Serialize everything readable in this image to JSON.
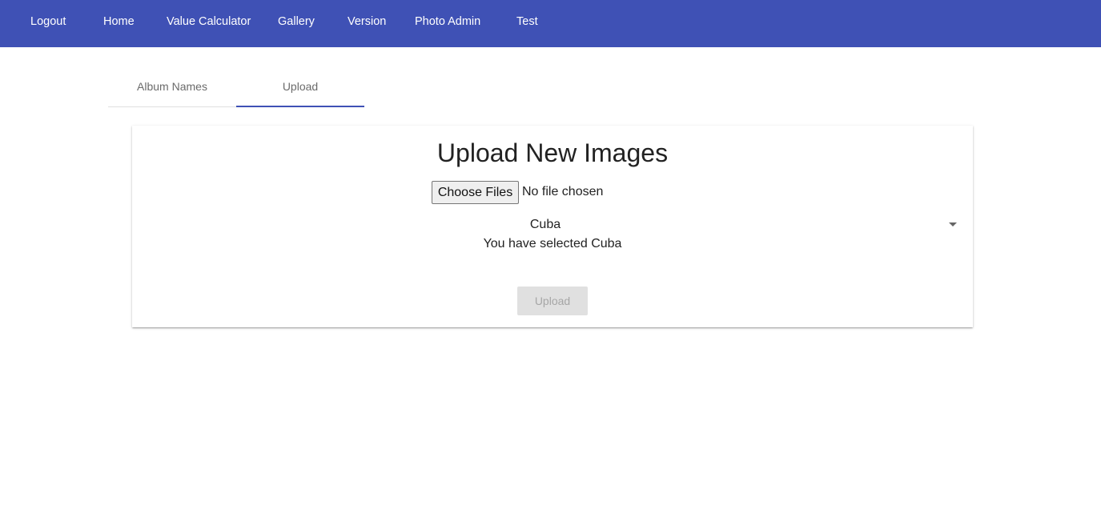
{
  "nav": {
    "items": [
      {
        "label": "Logout"
      },
      {
        "label": "Home"
      },
      {
        "label": "Value Calculator"
      },
      {
        "label": "Gallery"
      },
      {
        "label": "Version"
      },
      {
        "label": "Photo Admin"
      },
      {
        "label": "Test"
      }
    ],
    "background_color": "#3f51b5"
  },
  "tabs": {
    "items": [
      {
        "label": "Album Names",
        "active": false
      },
      {
        "label": "Upload",
        "active": true
      }
    ],
    "indicator_color": "#3f51b5"
  },
  "upload_card": {
    "title": "Upload New Images",
    "file_input": {
      "button_label": "Choose Files",
      "status": "No file chosen"
    },
    "album_select": {
      "value": "Cuba",
      "icon": "chevron-down-icon"
    },
    "selected_message": "You have selected Cuba",
    "upload_button": {
      "label": "Upload",
      "disabled": true
    }
  }
}
